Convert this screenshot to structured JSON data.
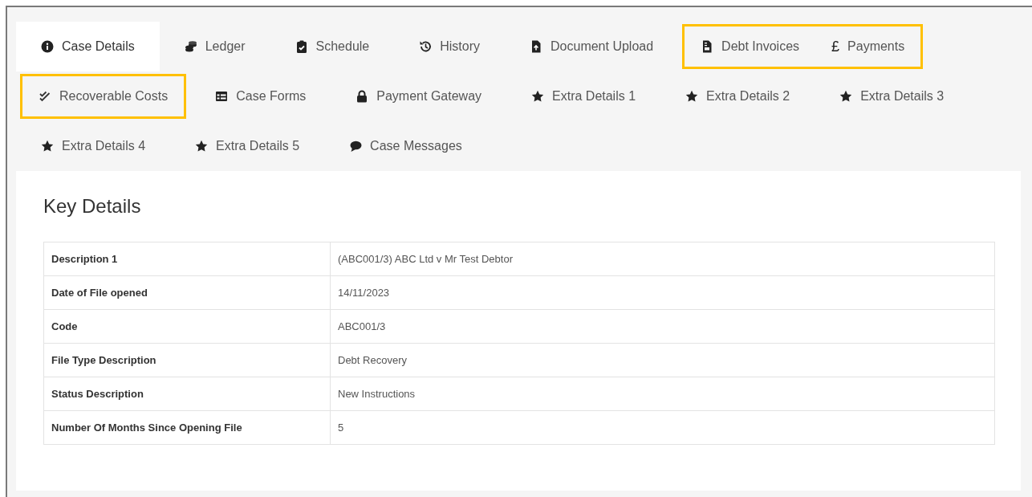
{
  "tab_groups": [
    {
      "highlighted": false,
      "tabs": [
        {
          "label": "Case Details",
          "kind": "info",
          "selected": true
        },
        {
          "label": "Ledger",
          "kind": "coins",
          "selected": false
        },
        {
          "label": "Schedule",
          "kind": "clipboard",
          "selected": false
        },
        {
          "label": "History",
          "kind": "history",
          "selected": false
        },
        {
          "label": "Document Upload",
          "kind": "upload",
          "selected": false
        }
      ]
    },
    {
      "highlighted": true,
      "tabs": [
        {
          "label": "Debt Invoices",
          "kind": "invoice",
          "selected": false
        },
        {
          "label": "Payments",
          "kind": "currency",
          "symbol": "£",
          "selected": false
        }
      ]
    },
    {
      "highlighted": true,
      "tabs": [
        {
          "label": "Recoverable Costs",
          "kind": "check",
          "selected": false
        }
      ]
    },
    {
      "highlighted": false,
      "tabs": [
        {
          "label": "Case Forms",
          "kind": "table",
          "selected": false
        },
        {
          "label": "Payment Gateway",
          "kind": "lock",
          "selected": false
        },
        {
          "label": "Extra Details 1",
          "kind": "star",
          "selected": false
        },
        {
          "label": "Extra Details 2",
          "kind": "star",
          "selected": false
        },
        {
          "label": "Extra Details 3",
          "kind": "star",
          "selected": false
        },
        {
          "label": "Extra Details 4",
          "kind": "star",
          "selected": false
        },
        {
          "label": "Extra Details 5",
          "kind": "star",
          "selected": false
        },
        {
          "label": "Case Messages",
          "kind": "comment",
          "selected": false
        }
      ]
    }
  ],
  "panel": {
    "title": "Key Details",
    "rows": [
      {
        "label": "Description 1",
        "value": "(ABC001/3) ABC Ltd v Mr Test Debtor"
      },
      {
        "label": "Date of File opened",
        "value": "14/11/2023"
      },
      {
        "label": "Code",
        "value": "ABC001/3"
      },
      {
        "label": "File Type Description",
        "value": "Debt Recovery"
      },
      {
        "label": "Status Description",
        "value": "New Instructions"
      },
      {
        "label": "Number Of Months Since Opening File",
        "value": "5"
      }
    ]
  }
}
